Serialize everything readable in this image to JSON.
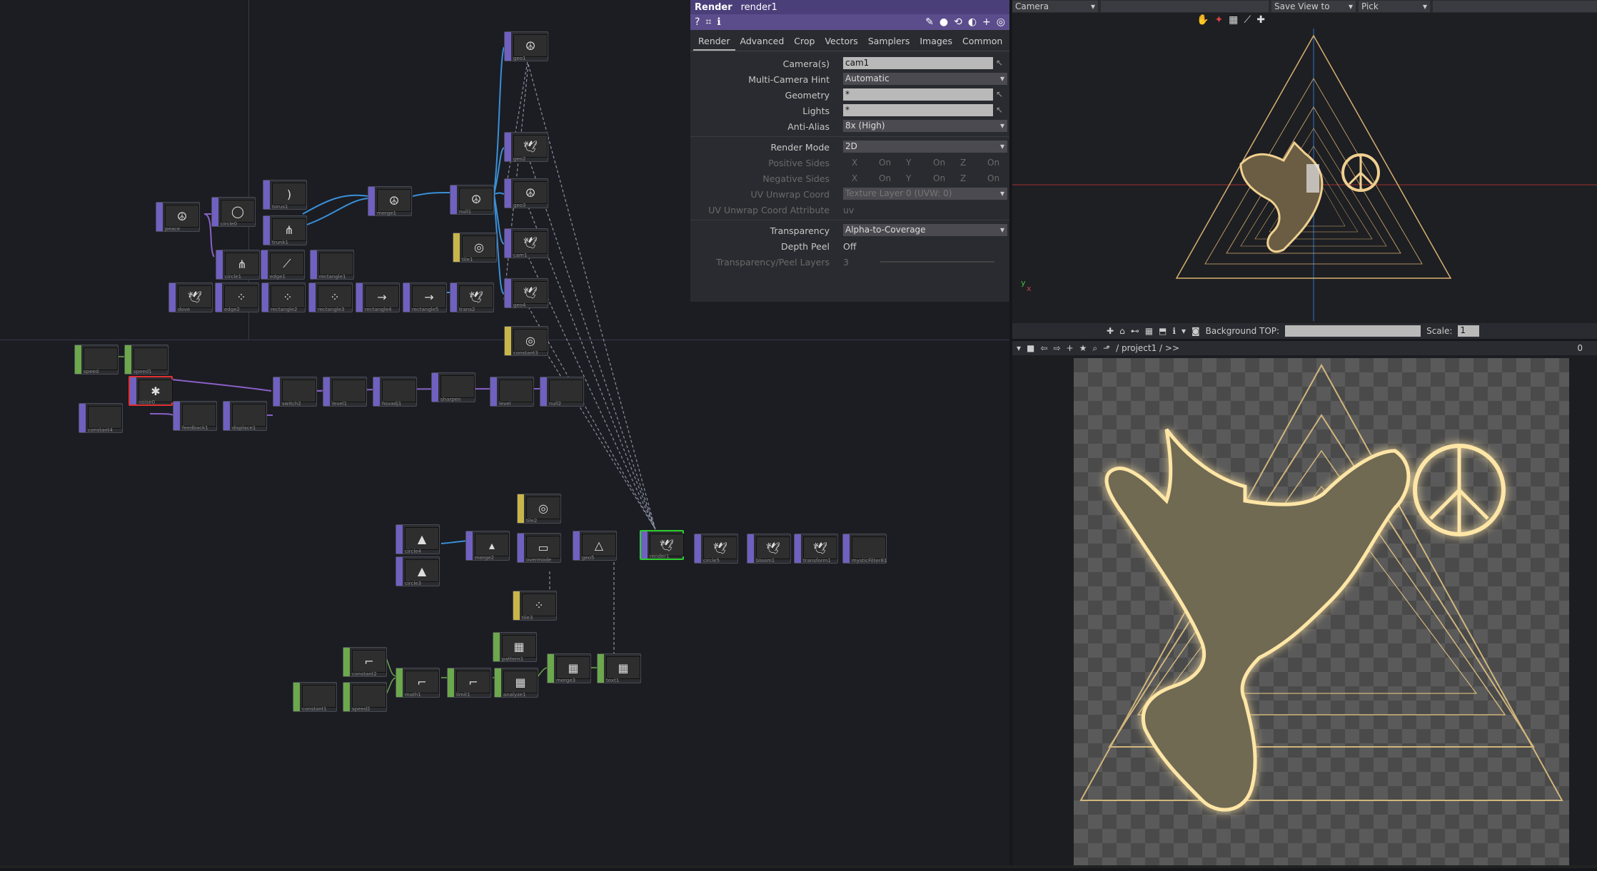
{
  "params": {
    "op_type": "Render",
    "op_name": "render1",
    "toolbar_icons": [
      "help-icon",
      "python-icon",
      "info-icon",
      "pencil-icon",
      "comment-icon",
      "refresh-icon",
      "color-icon",
      "plus-icon",
      "target-icon"
    ],
    "tabs": [
      "Render",
      "Advanced",
      "Crop",
      "Vectors",
      "Samplers",
      "Images",
      "Common"
    ],
    "active_tab": "Render",
    "cameras_label": "Camera(s)",
    "cameras_value": "cam1",
    "multicam_label": "Multi-Camera Hint",
    "multicam_value": "Automatic",
    "geometry_label": "Geometry",
    "geometry_value": "*",
    "lights_label": "Lights",
    "lights_value": "*",
    "antialias_label": "Anti-Alias",
    "antialias_value": "8x (High)",
    "rendermode_label": "Render Mode",
    "rendermode_value": "2D",
    "possides_label": "Positive Sides",
    "negsides_label": "Negative Sides",
    "x": "X",
    "y": "Y",
    "z": "Z",
    "on": "On",
    "uvcoord_label": "UV Unwrap Coord",
    "uvcoord_value": "Texture Layer 0 (UVW: 0)",
    "uvattr_label": "UV Unwrap Coord Attribute",
    "uvattr_value": "uv",
    "transparency_label": "Transparency",
    "transparency_value": "Alpha-to-Coverage",
    "depthpeel_label": "Depth Peel",
    "depthpeel_value": "Off",
    "peellayers_label": "Transparency/Peel Layers",
    "peellayers_value": "3"
  },
  "viewer": {
    "camera_menu": "Camera",
    "saveview_menu": "Save View to",
    "pick_menu": "Pick",
    "bg_label": "Background TOP:",
    "scale_label": "Scale:",
    "scale_value": "1",
    "axis_y": "y",
    "axis_x": "x"
  },
  "topviewer": {
    "path": "/ project1 / >>",
    "counter": "0"
  },
  "nodes": [
    {
      "id": "peace",
      "label": "peace",
      "glyph": "☮",
      "kind": "purple"
    },
    {
      "id": "circle0",
      "label": "circle0",
      "glyph": "◯",
      "kind": "purple"
    },
    {
      "id": "torus1",
      "label": "torus1",
      "glyph": ")",
      "kind": "purple"
    },
    {
      "id": "trunk1",
      "label": "trunk1",
      "glyph": "⋔",
      "kind": "purple"
    },
    {
      "id": "merge1",
      "label": "merge1",
      "glyph": "☮",
      "kind": "purple"
    },
    {
      "id": "null1",
      "label": "null1",
      "glyph": "☮",
      "kind": "purple"
    },
    {
      "id": "geo1",
      "label": "geo1",
      "glyph": "☮",
      "kind": "purple"
    },
    {
      "id": "geo2",
      "label": "geo2",
      "glyph": "🕊",
      "kind": "purple"
    },
    {
      "id": "geo3",
      "label": "geo3",
      "glyph": "☮",
      "kind": "purple"
    },
    {
      "id": "cam1",
      "label": "cam1",
      "glyph": "🕊",
      "kind": "purple"
    },
    {
      "id": "geo4",
      "label": "geo4",
      "glyph": "🕊",
      "kind": "purple"
    },
    {
      "id": "tile1",
      "label": "tile1",
      "glyph": "◎",
      "kind": "yellow"
    },
    {
      "id": "circle1",
      "label": "circle1",
      "glyph": "⋔",
      "kind": "purple"
    },
    {
      "id": "edge1",
      "label": "edge1",
      "glyph": "⟋",
      "kind": "purple"
    },
    {
      "id": "rect1",
      "label": "rectangle1",
      "glyph": "",
      "kind": "purple"
    },
    {
      "id": "dove",
      "label": "dove",
      "glyph": "🕊",
      "kind": "purple"
    },
    {
      "id": "edge2",
      "label": "edge2",
      "glyph": "⁘",
      "kind": "purple"
    },
    {
      "id": "rect2",
      "label": "rectangle2",
      "glyph": "⁘",
      "kind": "purple"
    },
    {
      "id": "rect3",
      "label": "rectangle3",
      "glyph": "⁘",
      "kind": "purple"
    },
    {
      "id": "rect4",
      "label": "rectangle4",
      "glyph": "→",
      "kind": "purple"
    },
    {
      "id": "rect5",
      "label": "rectangle5",
      "glyph": "→",
      "kind": "purple"
    },
    {
      "id": "trans2",
      "label": "trans2",
      "glyph": "🕊",
      "kind": "purple"
    },
    {
      "id": "const3",
      "label": "constant3",
      "glyph": "◎",
      "kind": "yellow"
    },
    {
      "id": "speed",
      "label": "speed",
      "glyph": "",
      "kind": "green"
    },
    {
      "id": "speed1",
      "label": "speed1",
      "glyph": "",
      "kind": "green"
    },
    {
      "id": "noise0",
      "label": "noise0",
      "glyph": "✱",
      "kind": "purple",
      "err": true
    },
    {
      "id": "constant4",
      "label": "constant4",
      "glyph": "",
      "kind": "purple"
    },
    {
      "id": "feedback1",
      "label": "feedback1",
      "glyph": "",
      "kind": "purple"
    },
    {
      "id": "displace1",
      "label": "displace1",
      "glyph": "",
      "kind": "purple"
    },
    {
      "id": "switch2",
      "label": "switch2",
      "glyph": "",
      "kind": "purple"
    },
    {
      "id": "level1",
      "label": "level1",
      "glyph": "",
      "kind": "purple"
    },
    {
      "id": "hsvadj1",
      "label": "hsvadj1",
      "glyph": "",
      "kind": "purple"
    },
    {
      "id": "sharpen",
      "label": "sharpen",
      "glyph": "",
      "kind": "purple"
    },
    {
      "id": "level",
      "label": "level",
      "glyph": "",
      "kind": "purple"
    },
    {
      "id": "null2",
      "label": "null2",
      "glyph": "",
      "kind": "purple"
    },
    {
      "id": "tile2",
      "label": "tile2",
      "glyph": "◎",
      "kind": "yellow"
    },
    {
      "id": "circle4",
      "label": "circle4",
      "glyph": "▲",
      "kind": "purple"
    },
    {
      "id": "circle3",
      "label": "circle3",
      "glyph": "▲",
      "kind": "purple"
    },
    {
      "id": "merge2",
      "label": "merge2",
      "glyph": "▴",
      "kind": "purple"
    },
    {
      "id": "overmode",
      "label": "overmode",
      "glyph": "▭",
      "kind": "purple"
    },
    {
      "id": "geo5",
      "label": "geo5",
      "glyph": "△",
      "kind": "purple"
    },
    {
      "id": "render1",
      "label": "render1",
      "glyph": "🕊",
      "kind": "purple",
      "sel": true
    },
    {
      "id": "circle5",
      "label": "circle5",
      "glyph": "🕊",
      "kind": "purple"
    },
    {
      "id": "bloom1",
      "label": "bloom1",
      "glyph": "🕊",
      "kind": "purple"
    },
    {
      "id": "transform1",
      "label": "transform1",
      "glyph": "🕊",
      "kind": "purple"
    },
    {
      "id": "mosaic",
      "label": "mysticFilter81",
      "glyph": "",
      "kind": "purple"
    },
    {
      "id": "tile3",
      "label": "tile3",
      "glyph": "⁘",
      "kind": "yellow"
    },
    {
      "id": "pattern1",
      "label": "pattern1",
      "glyph": "▦",
      "kind": "green"
    },
    {
      "id": "const2",
      "label": "constant2",
      "glyph": "⌐",
      "kind": "green"
    },
    {
      "id": "const1b",
      "label": "constant1",
      "glyph": "",
      "kind": "green"
    },
    {
      "id": "speed2",
      "label": "speed2",
      "glyph": "",
      "kind": "green"
    },
    {
      "id": "math1",
      "label": "math1",
      "glyph": "⌐",
      "kind": "green"
    },
    {
      "id": "limit1",
      "label": "limit1",
      "glyph": "⌐",
      "kind": "green"
    },
    {
      "id": "analyze1",
      "label": "analyze1",
      "glyph": "▦",
      "kind": "green"
    },
    {
      "id": "merge3",
      "label": "merge3",
      "glyph": "▦",
      "kind": "green"
    },
    {
      "id": "text1",
      "label": "text1",
      "glyph": "▦",
      "kind": "green"
    }
  ]
}
